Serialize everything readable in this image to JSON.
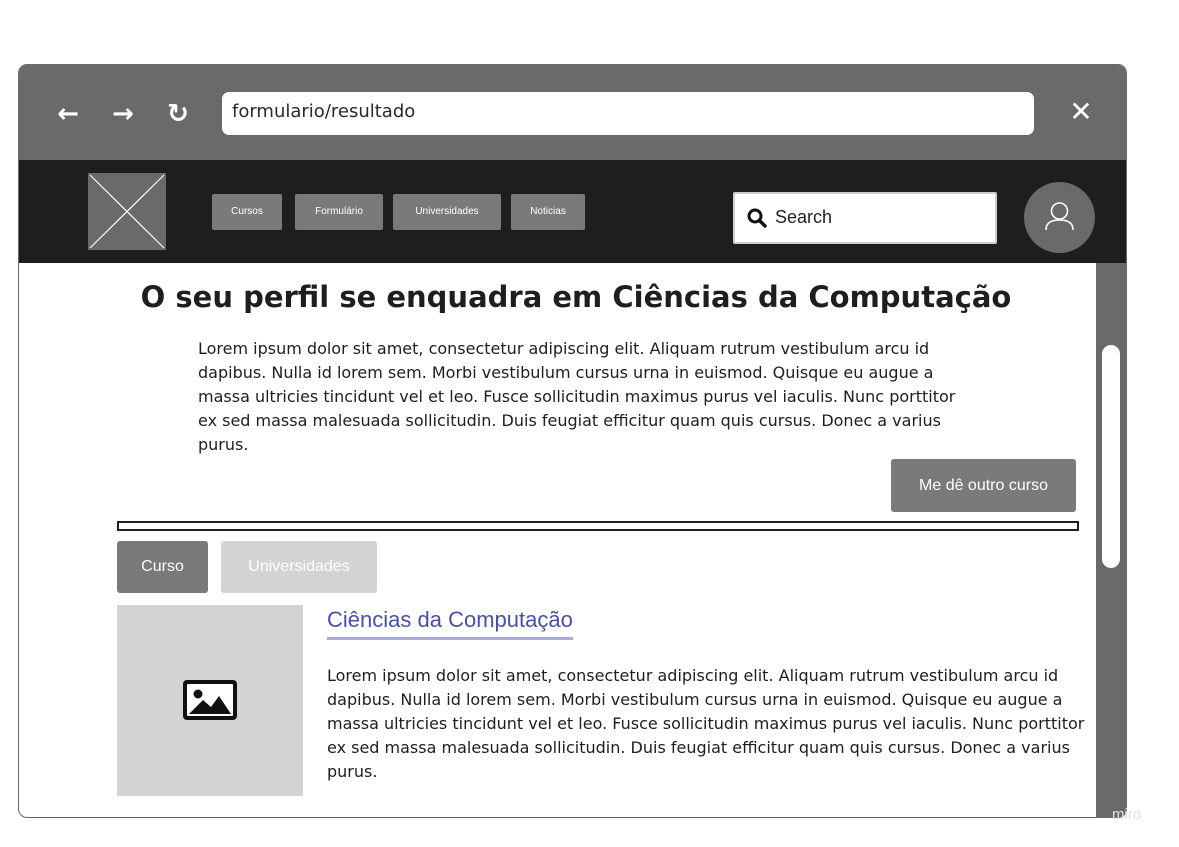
{
  "browser": {
    "url": "formulario/resultado",
    "back_icon": "←",
    "forward_icon": "→",
    "reload_icon": "↻",
    "close_icon": "✕"
  },
  "header": {
    "menu": [
      {
        "label": "Cursos"
      },
      {
        "label": "Formulário"
      },
      {
        "label": "Universidades"
      },
      {
        "label": "Noticias"
      }
    ],
    "search": {
      "label": "Search"
    }
  },
  "main": {
    "headline": "O seu perfil se enquadra em Ciências da Computação",
    "intro": "Lorem ipsum dolor sit amet, consectetur adipiscing elit. Aliquam rutrum vestibulum arcu id dapibus. Nulla id lorem sem. Morbi vestibulum cursus urna in euismod. Quisque eu augue a massa ultricies tincidunt vel et leo. Fusce sollicitudin maximus purus vel iaculis. Nunc porttitor ex sed massa malesuada sollicitudin. Duis feugiat efficitur quam quis cursus. Donec a varius purus.",
    "other_button": "Me dê outro curso",
    "tabs": [
      {
        "label": "Curso",
        "active": true
      },
      {
        "label": "Universidades",
        "active": false
      }
    ],
    "course": {
      "title": "Ciências da Computação",
      "description": "Lorem ipsum dolor sit amet, consectetur adipiscing elit. Aliquam rutrum vestibulum arcu id dapibus. Nulla id lorem sem. Morbi vestibulum cursus urna in euismod. Quisque eu augue a massa ultricies tincidunt vel et leo. Fusce sollicitudin maximus purus vel iaculis. Nunc porttitor ex sed massa malesuada sollicitudin. Duis feugiat efficitur quam quis cursus. Donec a varius purus."
    }
  },
  "watermark": "miro",
  "colors": {
    "chrome": "#6a6a6a",
    "header": "#1e1e1e",
    "button": "#7a7a7a",
    "link": "#4b4f9c",
    "inactive_tab": "#d3d3d3"
  }
}
